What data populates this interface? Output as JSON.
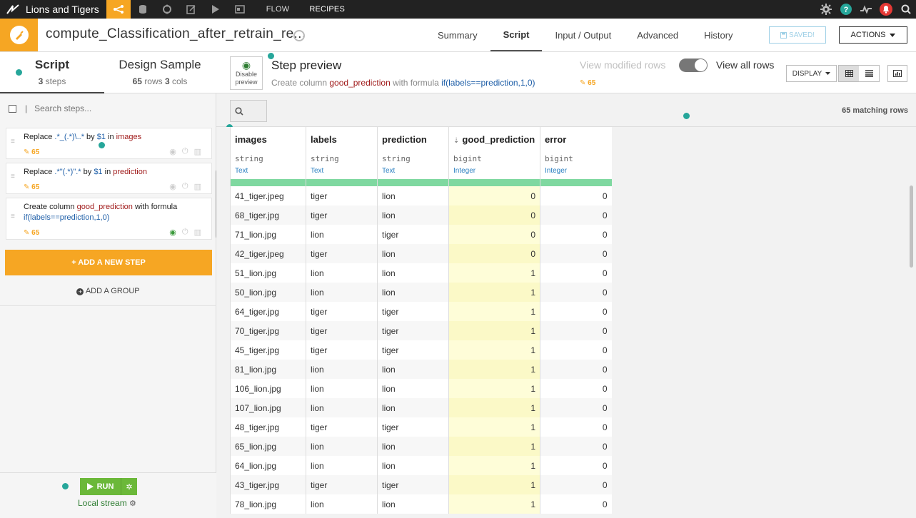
{
  "topnav": {
    "project_name": "Lions and Tigers",
    "links": [
      "FLOW",
      "RECIPES"
    ]
  },
  "header": {
    "recipe_title": "compute_Classification_after_retrain_re...",
    "tabs": [
      "Summary",
      "Script",
      "Input / Output",
      "Advanced",
      "History"
    ],
    "active_tab": "Script",
    "saved_label": "SAVED!",
    "actions_label": "ACTIONS"
  },
  "left_tabs": {
    "script": {
      "title": "Script",
      "count": "3",
      "unit": "steps"
    },
    "sample": {
      "title": "Design Sample",
      "rows": "65",
      "rows_unit": "rows",
      "cols": "3",
      "cols_unit": "cols"
    }
  },
  "search_steps": {
    "placeholder": "Search steps..."
  },
  "steps": [
    {
      "pre": "Replace ",
      "pattern": ".*_(.*)\\..*",
      "mid": " by ",
      "repl": "$1",
      "mid2": " in ",
      "col": "images",
      "count": "65"
    },
    {
      "pre": "Replace ",
      "pattern": ".*\"(.*)\".*",
      "mid": " by ",
      "repl": "$1",
      "mid2": " in ",
      "col": "prediction",
      "count": "65"
    },
    {
      "pre": "Create column ",
      "col": "good_prediction",
      "mid": " with formula ",
      "formula": "if(labels==prediction,1,0)",
      "count": "65"
    }
  ],
  "add_step_label": "+ ADD A NEW STEP",
  "add_group_label": "ADD A GROUP",
  "run": {
    "label": "RUN",
    "engine": "Local stream"
  },
  "preview": {
    "disable_label_1": "Disable",
    "disable_label_2": "preview",
    "title": "Step preview",
    "desc_pre": "Create column ",
    "desc_col": "good_prediction",
    "desc_mid": " with formula ",
    "desc_formula": "if(labels==prediction,1,0)",
    "view_modified": "View modified rows",
    "view_all": "View all rows",
    "modified_count": "65",
    "display_label": "DISPLAY"
  },
  "filter": {
    "matching": "65 matching rows"
  },
  "columns": [
    {
      "name": "images",
      "type": "string",
      "meaning": "Text"
    },
    {
      "name": "labels",
      "type": "string",
      "meaning": "Text"
    },
    {
      "name": "prediction",
      "type": "string",
      "meaning": "Text"
    },
    {
      "name": "good_prediction",
      "type": "bigint",
      "meaning": "Integer"
    },
    {
      "name": "error",
      "type": "bigint",
      "meaning": "Integer"
    }
  ],
  "rows": [
    [
      "41_tiger.jpeg",
      "tiger",
      "lion",
      "0",
      "0"
    ],
    [
      "68_tiger.jpg",
      "tiger",
      "lion",
      "0",
      "0"
    ],
    [
      "71_lion.jpg",
      "lion",
      "tiger",
      "0",
      "0"
    ],
    [
      "42_tiger.jpeg",
      "tiger",
      "lion",
      "0",
      "0"
    ],
    [
      "51_lion.jpg",
      "lion",
      "lion",
      "1",
      "0"
    ],
    [
      "50_lion.jpg",
      "lion",
      "lion",
      "1",
      "0"
    ],
    [
      "64_tiger.jpg",
      "tiger",
      "tiger",
      "1",
      "0"
    ],
    [
      "70_tiger.jpg",
      "tiger",
      "tiger",
      "1",
      "0"
    ],
    [
      "45_tiger.jpg",
      "tiger",
      "tiger",
      "1",
      "0"
    ],
    [
      "81_lion.jpg",
      "lion",
      "lion",
      "1",
      "0"
    ],
    [
      "106_lion.jpg",
      "lion",
      "lion",
      "1",
      "0"
    ],
    [
      "107_lion.jpg",
      "lion",
      "lion",
      "1",
      "0"
    ],
    [
      "48_tiger.jpg",
      "tiger",
      "tiger",
      "1",
      "0"
    ],
    [
      "65_lion.jpg",
      "lion",
      "lion",
      "1",
      "0"
    ],
    [
      "64_lion.jpg",
      "lion",
      "lion",
      "1",
      "0"
    ],
    [
      "43_tiger.jpg",
      "tiger",
      "tiger",
      "1",
      "0"
    ],
    [
      "78_lion.jpg",
      "lion",
      "lion",
      "1",
      "0"
    ]
  ],
  "colors": {
    "accent": "#f6a623",
    "run": "#6bb839",
    "valid": "#7fd8a0",
    "highlight": "#fefdd8"
  },
  "icons": [
    "logo-icon",
    "flow-icon",
    "datasets-icon",
    "recipes-icon",
    "notebook-icon",
    "run-icon",
    "dashboard-icon",
    "settings-icon",
    "help-icon",
    "activity-icon",
    "notifications-icon",
    "search-icon"
  ]
}
